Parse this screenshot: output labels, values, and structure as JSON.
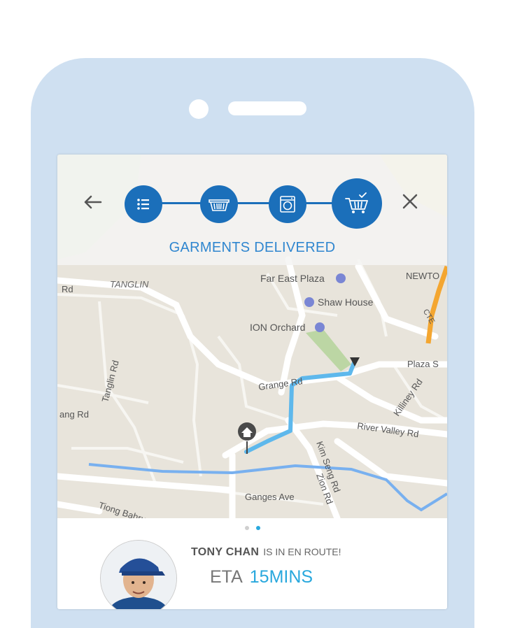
{
  "header": {
    "status_title": "GARMENTS DELIVERED",
    "steps": [
      {
        "name": "order-list",
        "icon": "list-icon"
      },
      {
        "name": "basket",
        "icon": "laundry-basket-icon"
      },
      {
        "name": "washing",
        "icon": "washing-machine-icon"
      },
      {
        "name": "delivered",
        "icon": "cart-check-icon"
      }
    ],
    "back_icon": "arrow-left-icon",
    "close_icon": "close-icon"
  },
  "map": {
    "labels": {
      "tanglin": "TANGLIN",
      "rd_left": "Rd",
      "far_east": "Far East Plaza",
      "shaw_house": "Shaw House",
      "ion_orchard": "ION Orchard",
      "newton": "NEWTO",
      "cte": "CTE",
      "plaza": "Plaza S",
      "tanglin_rd": "Tanglin Rd",
      "grange_rd": "Grange Rd",
      "killiney_rd": "Killiney Rd",
      "river_valley_rd": "River Valley Rd",
      "lang_rd": "ang Rd",
      "kim_seng_rd": "Kim Seng Rd",
      "zion_rd": "Zion Rd",
      "ganges_ave": "Ganges Ave",
      "tiong_bahru": "Tiong Bahru"
    }
  },
  "pager": {
    "pages": 2,
    "active": 2
  },
  "driver": {
    "name": "TONY CHAN",
    "status": "IS IN EN ROUTE!",
    "eta_label": "ETA",
    "eta_value": "15MINS"
  },
  "colors": {
    "accent_blue": "#1b6fba",
    "title_blue": "#2f86cf",
    "eta_blue": "#29a8dd",
    "route_blue": "#5eb8ec",
    "phone_frame": "#cfe0f1",
    "map_base": "#e9e5dc"
  }
}
